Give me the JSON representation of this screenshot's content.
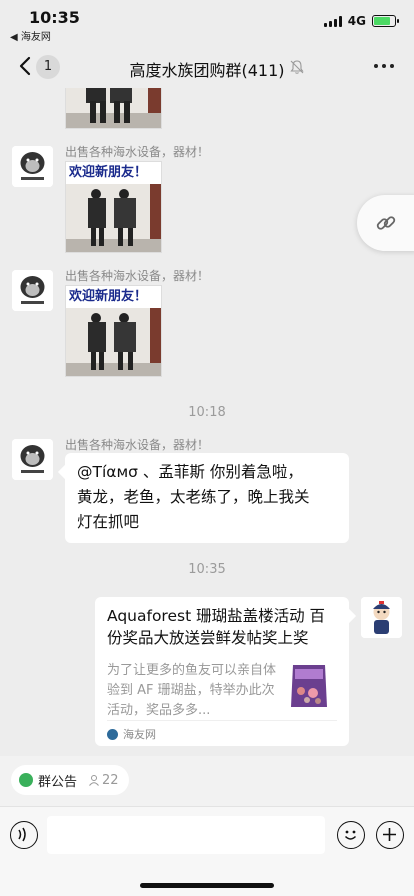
{
  "status_bar": {
    "time": "10:35",
    "back_app": "◀ 海友网",
    "network": "4G"
  },
  "nav": {
    "unread_count": "1",
    "title": "高度水族团购群(411)"
  },
  "messages": [
    {
      "type": "sticker",
      "sender": "出售各种海水设备，器材！",
      "caption": "欢迎新朋友！"
    },
    {
      "type": "sticker",
      "sender": "出售各种海水设备，器材！",
      "caption": "欢迎新朋友！"
    },
    {
      "type": "time",
      "text": "10:18"
    },
    {
      "type": "text",
      "sender": "出售各种海水设备，器材！",
      "text_line1": "@Tíαмσ 、孟菲斯 你别着急啦，",
      "text_line2": "黄龙，老鱼，太老练了，晚上我关",
      "text_line3": "灯在抓吧"
    },
    {
      "type": "time",
      "text": "10:35"
    },
    {
      "type": "link_card",
      "title": "Aquaforest 珊瑚盐盖楼活动 百份奖品大放送尝鲜发帖奖上奖",
      "desc": "为了让更多的鱼友可以亲自体验到 AF 珊瑚盐，特举办此次活动，奖品多多...",
      "source": "海友网"
    }
  ],
  "notice": {
    "label": "群公告",
    "members": "22"
  },
  "input": {
    "placeholder": ""
  },
  "colors": {
    "background": "#ededed",
    "bubble": "#ffffff",
    "notice_green": "#3ab05b",
    "battery_green": "#4cd964",
    "sticker_caption": "#1a2a8c"
  }
}
